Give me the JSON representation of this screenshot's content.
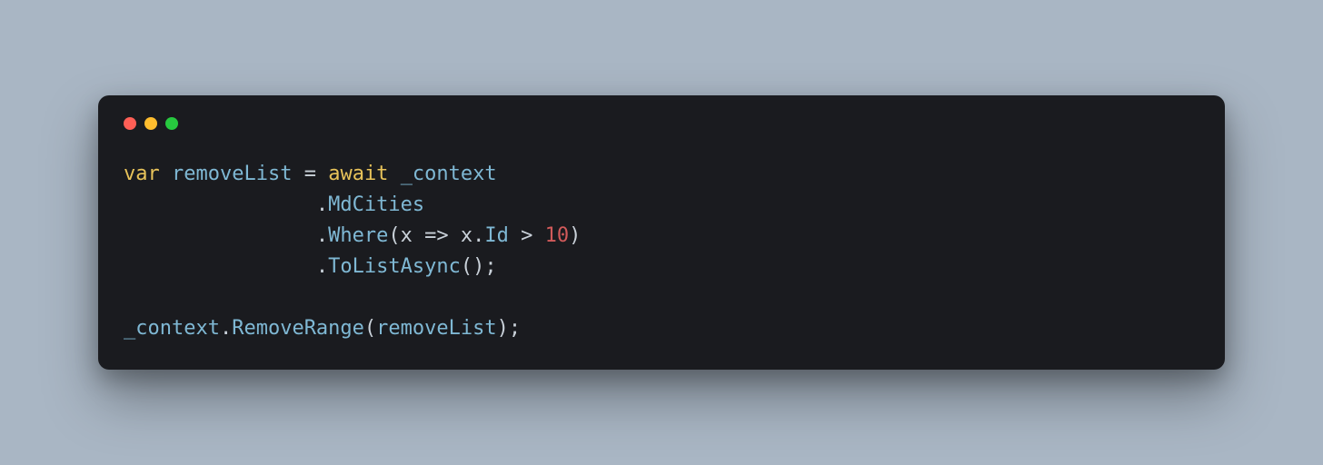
{
  "code": {
    "line1": {
      "kw_var": "var",
      "sp1": " ",
      "name": "removeList",
      "sp2": " ",
      "eq": "=",
      "sp3": " ",
      "kw_await": "await",
      "sp4": " ",
      "ctx": "_context"
    },
    "line2": {
      "indent": "                ",
      "dot": ".",
      "member": "MdCities"
    },
    "line3": {
      "indent": "                ",
      "dot": ".",
      "method": "Where",
      "open": "(",
      "param": "x",
      "sp1": " ",
      "arrow": "=>",
      "sp2": " ",
      "obj": "x",
      "dot2": ".",
      "prop": "Id",
      "sp3": " ",
      "gt": ">",
      "sp4": " ",
      "num": "10",
      "close": ")"
    },
    "line4": {
      "indent": "                ",
      "dot": ".",
      "method": "ToListAsync",
      "parens": "()",
      "semi": ";"
    },
    "blank": " ",
    "line5": {
      "ctx": "_context",
      "dot": ".",
      "method": "RemoveRange",
      "open": "(",
      "arg": "removeList",
      "close": ")",
      "semi": ";"
    }
  }
}
